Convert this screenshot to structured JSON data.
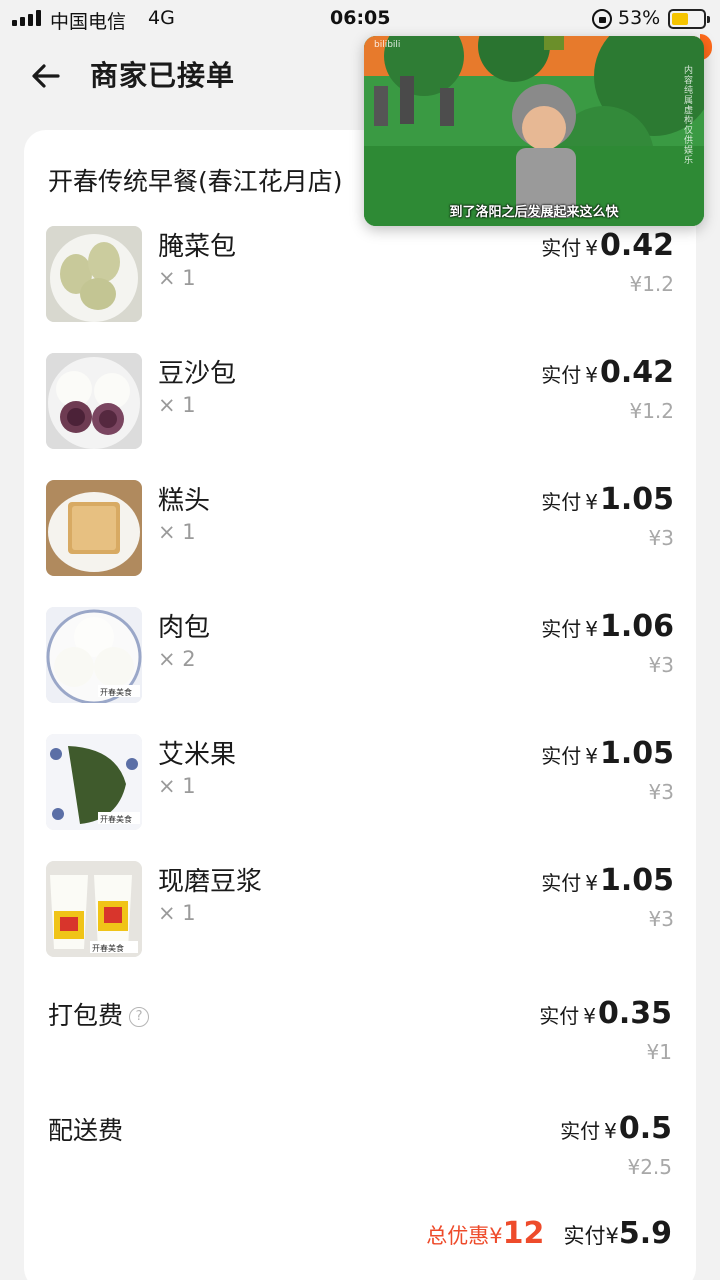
{
  "status_bar": {
    "carrier": "中国电信",
    "network": "4G",
    "time": "06:05",
    "battery": "53%",
    "battery_level": 0.53
  },
  "header": {
    "title": "商家已接单"
  },
  "order": {
    "shop_name": "开春传统早餐(春江花月店)",
    "items": [
      {
        "name": "腌菜包",
        "qty": "× 1",
        "paid_label": "实付",
        "currency": "¥",
        "paid": "0.42",
        "original": "¥1.2",
        "image": "pickled-vegetable-buns"
      },
      {
        "name": "豆沙包",
        "qty": "× 1",
        "paid_label": "实付",
        "currency": "¥",
        "paid": "0.42",
        "original": "¥1.2",
        "image": "red-bean-buns"
      },
      {
        "name": "糕头",
        "qty": "× 1",
        "paid_label": "实付",
        "currency": "¥",
        "paid": "1.05",
        "original": "¥3",
        "image": "rice-cake"
      },
      {
        "name": "肉包",
        "qty": "× 2",
        "paid_label": "实付",
        "currency": "¥",
        "paid": "1.06",
        "original": "¥3",
        "image": "meat-buns"
      },
      {
        "name": "艾米果",
        "qty": "× 1",
        "paid_label": "实付",
        "currency": "¥",
        "paid": "1.05",
        "original": "¥3",
        "image": "mugwort-dumpling"
      },
      {
        "name": "现磨豆浆",
        "qty": "× 1",
        "paid_label": "实付",
        "currency": "¥",
        "paid": "1.05",
        "original": "¥3",
        "image": "soy-milk-cups"
      }
    ],
    "fees": [
      {
        "name": "打包费",
        "has_help": true,
        "paid_label": "实付",
        "currency": "¥",
        "paid": "0.35",
        "original": "¥1"
      },
      {
        "name": "配送费",
        "has_help": false,
        "paid_label": "实付",
        "currency": "¥",
        "paid": "0.5",
        "original": "¥2.5"
      }
    ],
    "total": {
      "discount_label": "总优惠¥",
      "discount": "12",
      "paid_label": "实付¥",
      "paid": "5.9"
    }
  },
  "video": {
    "subtitle": "到了洛阳之后发展起来这么快",
    "logo": "bilibili",
    "watermark": "内容纯属虚构仅供娱乐"
  },
  "colors": {
    "discount": "#ee4b2b",
    "battery": "#f5c400",
    "video_bg": "#2f8a3c"
  }
}
